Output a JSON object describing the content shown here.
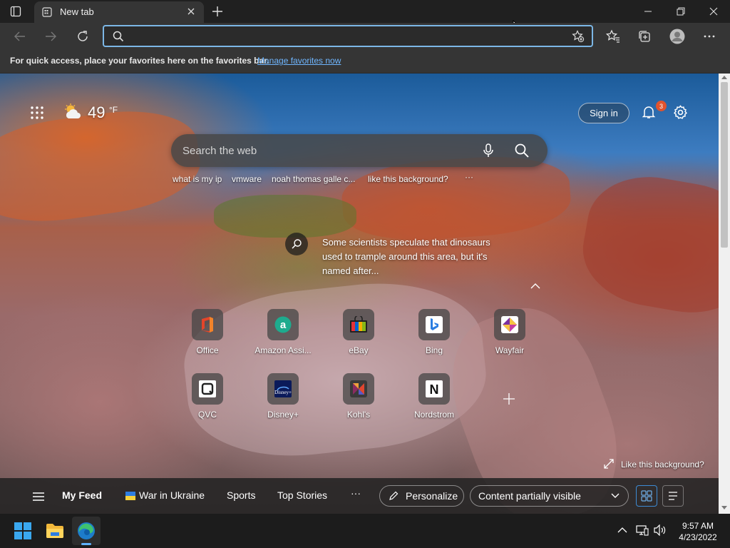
{
  "window": {
    "tab_title": "New tab",
    "tab_icon": "new-tab-page-icon",
    "new_tab_icon": "plus-icon"
  },
  "toolbar": {
    "address_value": "",
    "address_placeholder": ""
  },
  "favorites_bar": {
    "message": "For quick access, place your favorites here on the favorites bar.",
    "link": "Manage favorites now"
  },
  "weather": {
    "temperature": "49",
    "unit": "°F",
    "icon": "partly-cloudy-icon"
  },
  "header": {
    "sign_in": "Sign in",
    "notification_count": "3"
  },
  "search": {
    "placeholder": "Search the web",
    "suggestions": [
      "what is my ip",
      "vmware",
      "noah thomas galle c...",
      "like this background?"
    ],
    "more": "···"
  },
  "background_info": {
    "text": "Some scientists speculate that dinosaurs used to trample around this area, but it's named after..."
  },
  "quick_links": [
    {
      "label": "Office",
      "icon": "office-icon",
      "color": "#e3452a"
    },
    {
      "label": "Amazon Assi...",
      "icon": "amazon-assistant-icon",
      "color": "#1eab8e"
    },
    {
      "label": "eBay",
      "icon": "ebay-icon",
      "color": "#e53238"
    },
    {
      "label": "Bing",
      "icon": "bing-icon",
      "color": "#2a7de1"
    },
    {
      "label": "Wayfair",
      "icon": "wayfair-icon",
      "color": "#7b2fa0"
    },
    {
      "label": "QVC",
      "icon": "qvc-icon",
      "color": "#ffffff"
    },
    {
      "label": "Disney+",
      "icon": "disney-plus-icon",
      "color": "#0b1a5a"
    },
    {
      "label": "Kohl's",
      "icon": "kohls-icon",
      "color": "#8b2b61"
    },
    {
      "label": "Nordstrom",
      "icon": "nordstrom-icon",
      "color": "#ffffff"
    }
  ],
  "like_background": "Like this background?",
  "feed": {
    "my_feed": "My Feed",
    "items": [
      "War in Ukraine",
      "Sports",
      "Top Stories"
    ],
    "more": "···",
    "personalize": "Personalize",
    "visibility": "Content partially visible"
  },
  "taskbar": {
    "time": "9:57 AM",
    "date": "4/23/2022"
  }
}
